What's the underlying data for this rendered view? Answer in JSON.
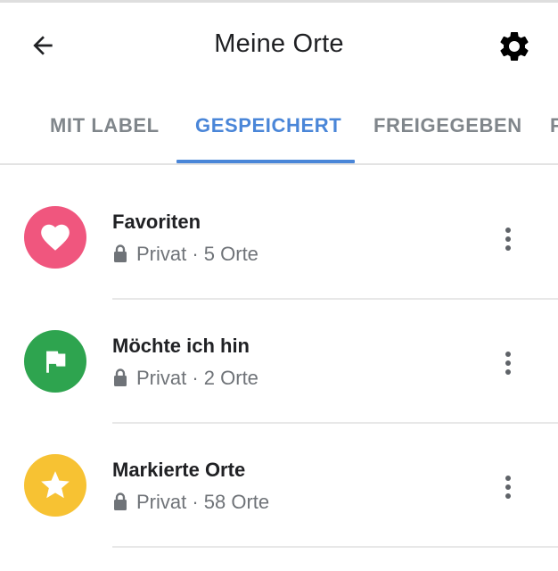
{
  "appbar": {
    "title": "Meine Orte",
    "back_icon": "arrow-left-icon",
    "settings_icon": "gear-icon"
  },
  "tabs": [
    {
      "label": "MIT LABEL",
      "active": false
    },
    {
      "label": "GESPEICHERT",
      "active": true
    },
    {
      "label": "FREIGEGEBEN",
      "active": false
    },
    {
      "label": "F",
      "active": false
    }
  ],
  "lists": [
    {
      "title": "Favoriten",
      "visibility": "Privat",
      "count": "5 Orte",
      "subtitle": "Privat · 5 Orte",
      "icon": "heart-icon",
      "color": "#f0567e"
    },
    {
      "title": "Möchte ich hin",
      "visibility": "Privat",
      "count": "2 Orte",
      "subtitle": "Privat · 2 Orte",
      "icon": "flag-icon",
      "color": "#2ea44f"
    },
    {
      "title": "Markierte Orte",
      "visibility": "Privat",
      "count": "58 Orte",
      "subtitle": "Privat · 58 Orte",
      "icon": "star-icon",
      "color": "#f7c233"
    }
  ],
  "colors": {
    "accent": "#4a86d8",
    "text_primary": "#202124",
    "text_secondary": "#6f7378"
  }
}
